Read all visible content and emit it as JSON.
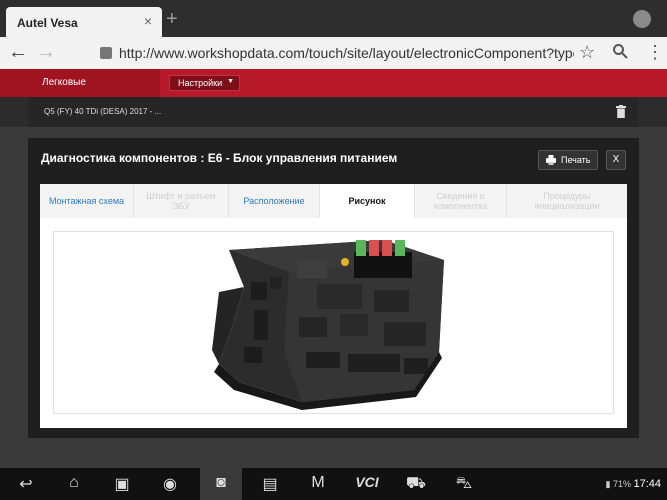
{
  "browser": {
    "tab_title": "Autel Vesa",
    "tab_close": "×",
    "new_tab": "+",
    "url": "http://www.workshopdata.com/touch/site/layout/electronicComponent?typeId=t_"
  },
  "app": {
    "category": "Легковые",
    "settings_label": "Настройки",
    "vehicle": "Q5 (FY) 40 TDi (DESA) 2017 - ..."
  },
  "dialog": {
    "title": "Диагностика компонентов : E6 - Блок управления питанием",
    "print_label": "Печать",
    "close_label": "X",
    "tabs": [
      {
        "label": "Монтажная схема",
        "state": "link"
      },
      {
        "label": "Штифт и разъем ЭБУ",
        "state": "disabled"
      },
      {
        "label": "Расположение",
        "state": "link"
      },
      {
        "label": "Рисунок",
        "state": "active"
      },
      {
        "label": "Сведения о компонентах",
        "state": "disabled"
      },
      {
        "label": "Процедуры инициализации",
        "state": "disabled"
      }
    ]
  },
  "navbar": {
    "icons": [
      "back-icon",
      "home-icon",
      "recents-icon",
      "chrome-icon",
      "camera-icon",
      "screenshot-icon",
      "maxisys-icon",
      "vci-icon",
      "car-icon",
      "car-check-icon"
    ],
    "vci_label": "VCI",
    "battery": "71%",
    "time": "17:44"
  },
  "colors": {
    "accent_red": "#b8192a",
    "link_blue": "#2a7cc7",
    "fuse_green": "#5bb55a",
    "fuse_red": "#d9504f"
  }
}
